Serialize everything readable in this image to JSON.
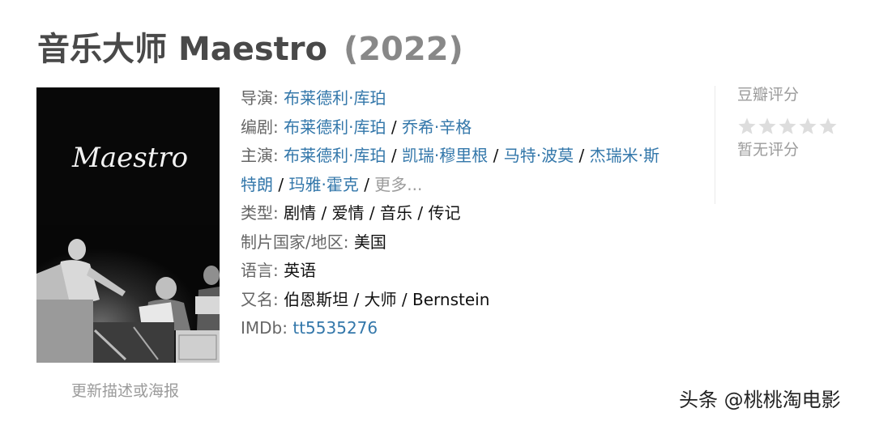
{
  "movie": {
    "title_cn": "音乐大师",
    "title_en": "Maestro",
    "year": "(2022)",
    "poster_title": "Maestro",
    "update_link": "更新描述或海报"
  },
  "info": {
    "director": {
      "label": "导演:",
      "names": [
        "布莱德利·库珀"
      ]
    },
    "writer": {
      "label": "编剧:",
      "names": [
        "布莱德利·库珀",
        "乔希·辛格"
      ]
    },
    "cast": {
      "label": "主演:",
      "line1": [
        "布莱德利·库珀",
        "凯瑞·穆里根",
        "马特·波莫",
        "杰瑞米·斯"
      ],
      "line2": [
        "特朗",
        "玛雅·霍克"
      ],
      "more": "更多..."
    },
    "genre": {
      "label": "类型:",
      "value": "剧情 / 爱情 / 音乐 / 传记"
    },
    "country": {
      "label": "制片国家/地区:",
      "value": "美国"
    },
    "language": {
      "label": "语言:",
      "value": "英语"
    },
    "aka": {
      "label": "又名:",
      "value": "伯恩斯坦 / 大师 / Bernstein"
    },
    "imdb": {
      "label": "IMDb:",
      "value": "tt5535276"
    }
  },
  "rating": {
    "label": "豆瓣评分",
    "stars_filled": 0,
    "stars_total": 5,
    "status": "暂无评分"
  },
  "watermark": "头条 @桃桃淘电影",
  "colors": {
    "link": "#3377aa",
    "label": "#666666",
    "muted": "#9b9b9b",
    "title": "#494949",
    "star_empty": "#dddddd"
  }
}
